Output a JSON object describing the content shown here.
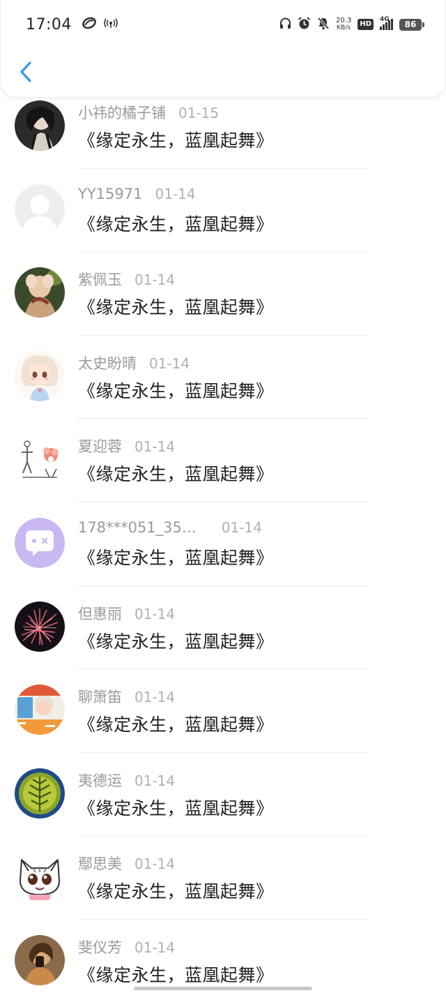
{
  "status_bar": {
    "time": "17:04",
    "net_speed_value": "20.3",
    "net_speed_unit": "KB/s",
    "hd_label": "HD",
    "network_label": "4G",
    "battery_level": "86"
  },
  "header": {
    "back_icon": "chevron-left-icon",
    "accent_color": "#2f9bea"
  },
  "comments": [
    {
      "username": "小祎的橘子铺",
      "date": "01-15",
      "text": "《缘定永生，蓝凰起舞》"
    },
    {
      "username": "YY15971",
      "date": "01-14",
      "text": "《缘定永生，蓝凰起舞》"
    },
    {
      "username": "紫佩玉",
      "date": "01-14",
      "text": "《缘定永生，蓝凰起舞》"
    },
    {
      "username": "太史盼晴",
      "date": "01-14",
      "text": "《缘定永生，蓝凰起舞》"
    },
    {
      "username": "夏迎蓉",
      "date": "01-14",
      "text": "《缘定永生，蓝凰起舞》"
    },
    {
      "username": "178***051_35…",
      "date": "01-14",
      "text": "《缘定永生，蓝凰起舞》"
    },
    {
      "username": "但惠丽",
      "date": "01-14",
      "text": "《缘定永生，蓝凰起舞》"
    },
    {
      "username": "聊箫笛",
      "date": "01-14",
      "text": "《缘定永生，蓝凰起舞》"
    },
    {
      "username": "夷德运",
      "date": "01-14",
      "text": "《缘定永生，蓝凰起舞》"
    },
    {
      "username": "鄢思美",
      "date": "01-14",
      "text": "《缘定永生，蓝凰起舞》"
    },
    {
      "username": "斐仪芳",
      "date": "01-14",
      "text": "《缘定永生，蓝凰起舞》"
    }
  ]
}
